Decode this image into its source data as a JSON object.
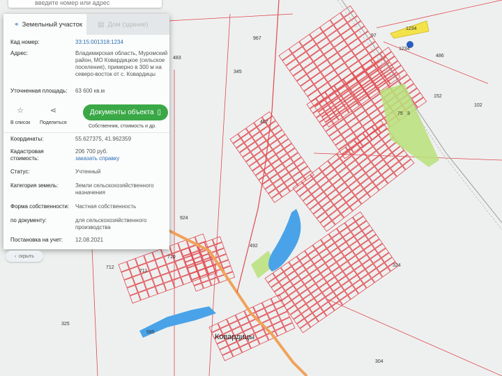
{
  "search": {
    "placeholder": "введите номер или адрес"
  },
  "tabs": [
    {
      "label": "Земельный участок",
      "icon": "map-pin-icon"
    },
    {
      "label": "Дом (здание)",
      "icon": "building-icon"
    }
  ],
  "fields": {
    "cad_number_label": "Кад номер:",
    "cad_number": "33:15:001318:1234",
    "address_label": "Адрес:",
    "address": [
      "Владимирская область, Муромский",
      "район, МО Ковардицкое (сельское",
      "поселение), примерно в 300 м на",
      "северо-восток от с. Ковардицы"
    ],
    "area_label": "Уточненная площадь:",
    "area": "63 600 кв.м",
    "coords_label": "Координаты:",
    "coords": "55.627375, 41.962359",
    "cost_label": [
      "Кадастровая",
      "стоимость:"
    ],
    "cost": "206 700 руб.",
    "cost_link": "заказать справку",
    "status_label": "Статус:",
    "status": "Учтенный",
    "category_label": "Категория земель:",
    "category": [
      "Земли сельскохозяйственного",
      "назначения"
    ],
    "ownership_label": "Форма собственности:",
    "ownership": "Частная собственность",
    "by_doc_label": "по документу:",
    "by_doc": [
      "для сельскохозяйственного",
      "производства"
    ],
    "registered_label": "Постановка на учет:",
    "registered": "12.08.2021"
  },
  "actions": {
    "favorite": "В список",
    "share": "Поделиться",
    "documents_button": "Документы объекта",
    "documents_sub": "Собственник, стоимость и др."
  },
  "hide_button": "скрыть",
  "map_labels": [
    "967",
    "1234",
    "1234",
    "486",
    "483",
    "345",
    "97",
    "152",
    "102",
    "75",
    "3",
    "407",
    "924",
    "492",
    "710",
    "711",
    "712",
    "324",
    "325",
    "304",
    "585",
    "Ковардицы"
  ],
  "colors": {
    "parcel_line": "#e0474c",
    "selected_parcel": "#f2e34a",
    "water": "#4aa3e8",
    "green_area": "#b8e07a",
    "road": "#f0a35a",
    "button_green": "#3aa846",
    "link": "#2a6fb3"
  }
}
